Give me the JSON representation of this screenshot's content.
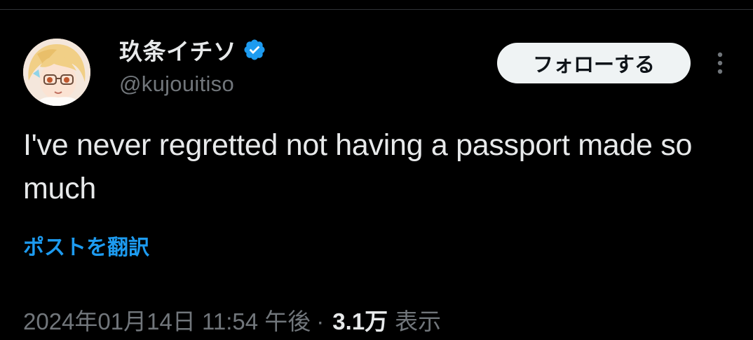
{
  "tweet": {
    "author": {
      "display_name": "玖条イチソ",
      "handle": "@kujouitiso",
      "verified": true
    },
    "follow_label": "フォローする",
    "more_icon": "more-vertical-icon",
    "text": "I've never regretted not having a passport made so much",
    "translate_label": "ポストを翻訳",
    "timestamp": "2024年01月14日 11:54 午後",
    "separator": "·",
    "views_count": "3.1万",
    "views_label": "表示"
  },
  "colors": {
    "background": "#000000",
    "text_primary": "#e7e9ea",
    "text_secondary": "#71767b",
    "accent": "#1d9bf0",
    "follow_bg": "#eff3f4"
  }
}
